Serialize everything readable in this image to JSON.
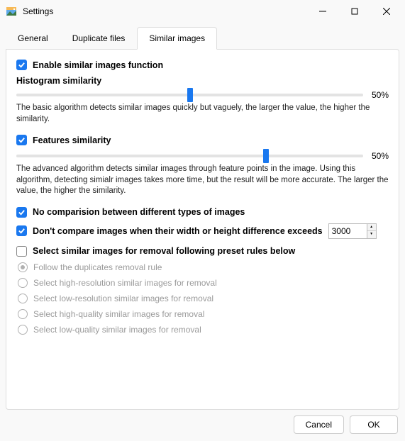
{
  "window": {
    "title": "Settings"
  },
  "tabs": [
    {
      "label": "General"
    },
    {
      "label": "Duplicate files"
    },
    {
      "label": "Similar images"
    }
  ],
  "enableSimilar": {
    "label": "Enable similar images function"
  },
  "histogram": {
    "title": "Histogram similarity",
    "value_pct": "50%",
    "thumb_pos_pct": 50,
    "desc": "The basic algorithm detects similar images quickly but vaguely, the larger the value, the higher the similarity."
  },
  "features": {
    "label": "Features similarity",
    "value_pct": "50%",
    "thumb_pos_pct": 72,
    "desc": "The advanced algorithm detects similar images through feature points in the image. Using this algorithm, detecting simialr images takes more time, but the result will be more accurate. The larger the value, the higher the similarity."
  },
  "noCompareTypes": {
    "label": "No comparision between different types of images"
  },
  "dimThreshold": {
    "label": "Don't compare images when their width or height difference exceeds",
    "value": "3000"
  },
  "presetRules": {
    "label": "Select similar images for removal following preset rules below",
    "options": [
      "Follow the duplicates removal rule",
      "Select high-resolution similar images for removal",
      "Select low-resolution similar images for removal",
      "Select high-quality similar images for removal",
      "Select low-quality similar images for removal"
    ]
  },
  "footer": {
    "cancel": "Cancel",
    "ok": "OK"
  }
}
